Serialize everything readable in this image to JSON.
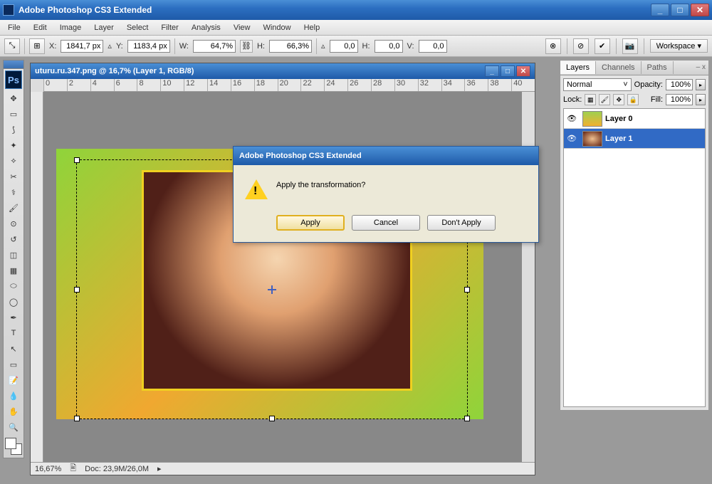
{
  "app": {
    "title": "Adobe Photoshop CS3 Extended"
  },
  "menus": [
    "File",
    "Edit",
    "Image",
    "Layer",
    "Select",
    "Filter",
    "Analysis",
    "View",
    "Window",
    "Help"
  ],
  "options": {
    "x_label": "X:",
    "x": "1841,7 px",
    "y_label": "Y:",
    "y": "1183,4 px",
    "w_label": "W:",
    "w": "64,7%",
    "h_label": "H:",
    "h": "66,3%",
    "rot_label": "▵",
    "rot": "0,0",
    "hskew_label": "H:",
    "hskew": "0,0",
    "vskew_label": "V:",
    "vskew": "0,0",
    "workspace": "Workspace ▾"
  },
  "doc": {
    "title": "uturu.ru.347.png @ 16,7% (Layer 1, RGB/8)",
    "ruler_ticks": [
      "0",
      "2",
      "4",
      "6",
      "8",
      "10",
      "12",
      "14",
      "16",
      "18",
      "20",
      "22",
      "24",
      "26",
      "28",
      "30",
      "32",
      "34",
      "36",
      "38",
      "40"
    ],
    "status_zoom": "16,67%",
    "status_doc": "Doc: 23,9M/26,0M"
  },
  "dialog": {
    "title": "Adobe Photoshop CS3 Extended",
    "message": "Apply the transformation?",
    "apply": "Apply",
    "cancel": "Cancel",
    "dont_apply": "Don't Apply"
  },
  "panels": {
    "tabs": [
      "Layers",
      "Channels",
      "Paths"
    ],
    "blend_mode": "Normal",
    "opacity_label": "Opacity:",
    "opacity": "100%",
    "lock_label": "Lock:",
    "fill_label": "Fill:",
    "fill": "100%",
    "layers": [
      {
        "name": "Layer 0"
      },
      {
        "name": "Layer 1"
      }
    ]
  }
}
